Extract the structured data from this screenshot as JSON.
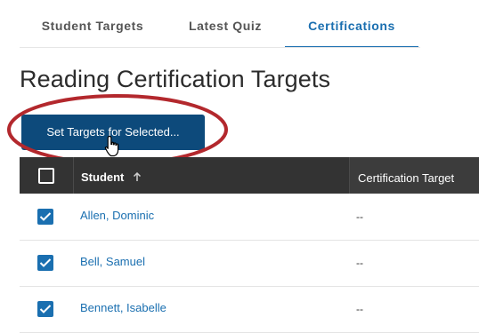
{
  "tabs": [
    {
      "label": "Student Targets",
      "active": false
    },
    {
      "label": "Latest Quiz",
      "active": false
    },
    {
      "label": "Certifications",
      "active": true
    }
  ],
  "page_title": "Reading Certification Targets",
  "set_targets_button": "Set Targets for Selected...",
  "table": {
    "header_checkbox_checked": false,
    "columns": [
      "Student",
      "Certification Target"
    ],
    "sort_column": "Student",
    "sort_direction": "ascending",
    "rows": [
      {
        "name": "Allen, Dominic",
        "target": "--",
        "checked": true
      },
      {
        "name": "Bell, Samuel",
        "target": "--",
        "checked": true
      },
      {
        "name": "Bennett, Isabelle",
        "target": "--",
        "checked": true
      }
    ]
  },
  "colors": {
    "accent": "#1a6fb0",
    "button": "#0d4a7b",
    "header_bg": "#333333",
    "annotation_ring": "#b3282d"
  },
  "icons": [
    "sort-up-arrow-icon",
    "checkmark-icon",
    "hand-pointer-cursor-icon"
  ]
}
